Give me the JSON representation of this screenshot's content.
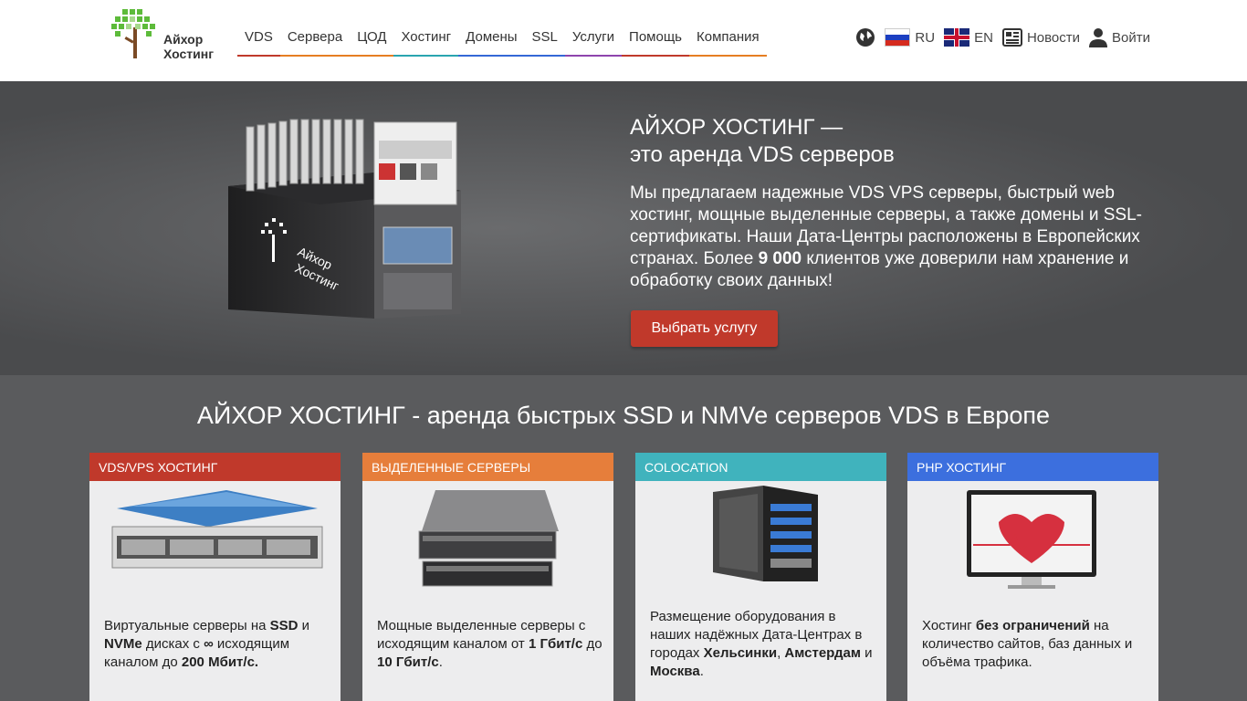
{
  "header": {
    "logo_line1": "Айхор",
    "logo_line2": "Хостинг",
    "nav": [
      {
        "label": "VDS",
        "color": "#c0392b"
      },
      {
        "label": "Сервера",
        "color": "#e67e22"
      },
      {
        "label": "ЦОД",
        "color": "#e67e22"
      },
      {
        "label": "Хостинг",
        "color": "#2aa5b0"
      },
      {
        "label": "Домены",
        "color": "#3467d6"
      },
      {
        "label": "SSL",
        "color": "#3467d6"
      },
      {
        "label": "Услуги",
        "color": "#8e44ad"
      },
      {
        "label": "Помощь",
        "color": "#c0392b"
      },
      {
        "label": "Компания",
        "color": "#e67e22"
      }
    ],
    "lang_ru": "RU",
    "lang_en": "EN",
    "news": "Новости",
    "login": "Войти"
  },
  "hero": {
    "title_line1": "АЙХОР ХОСТИНГ —",
    "title_line2": "это аренда VDS серверов",
    "text_part1": "Мы предлагаем надежные VDS VPS серверы, быстрый web хостинг, мощные выделенные серверы, а также домены и SSL-сертификаты. Наши Дата-Центры расположены в Европейских странах. Более ",
    "text_bold": "9 000",
    "text_part2": " клиентов уже доверили нам хранение и обработку своих данных!",
    "cta": "Выбрать услугу",
    "box_label1": "Айхор",
    "box_label2": "Хостинг"
  },
  "section": {
    "title": "АЙХОР ХОСТИНГ - аренда быстрых SSD и NMVe серверов VDS в Европе"
  },
  "cards": [
    {
      "title": "VDS/VPS ХОСТИНГ",
      "color": "#c0392b"
    },
    {
      "title": "ВЫДЕЛЕННЫЕ СЕРВЕРЫ",
      "color": "#e67e3b"
    },
    {
      "title": "COLOCATION",
      "color": "#40b3bd"
    },
    {
      "title": "PHP ХОСТИНГ",
      "color": "#3c6fde"
    }
  ],
  "card_texts": {
    "vds": {
      "t1": "Виртуальные серверы на ",
      "b1": "SSD",
      "t2": " и ",
      "b2": "NVMe",
      "t3": " дисках с ",
      "b3": "∞",
      "t4": " исходящим каналом до ",
      "b4": "200 Мбит/с."
    },
    "dedicated": {
      "t1": "Мощные выделенные серверы с исходящим каналом от ",
      "b1": "1 Гбит/с",
      "t2": " до ",
      "b2": "10 Гбит/с",
      "t3": "."
    },
    "colo": {
      "t1": "Размещение оборудования в наших надёжных Дата-Центрах в городах ",
      "b1": "Хельсинки",
      "t2": ", ",
      "b2": "Амстердам",
      "t3": " и ",
      "b3": "Москва",
      "t4": "."
    },
    "php": {
      "t1": "Хостинг ",
      "b1": "без ограничений",
      "t2": " на количество сайтов, баз данных и объёма трафика."
    }
  }
}
